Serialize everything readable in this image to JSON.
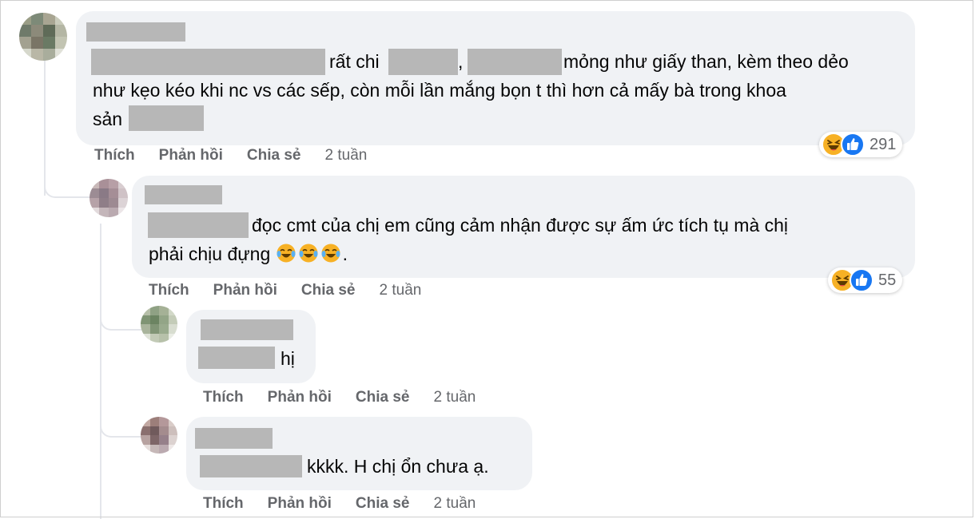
{
  "colors": {
    "bubble_bg": "#f0f2f5",
    "redaction": "#b7b7b7",
    "meta_text": "#65676b",
    "like_blue": "#1877f2",
    "haha_yellow": "#f7b125"
  },
  "comments": [
    {
      "id": "c1",
      "line1_mid": "rất chi",
      "line1_sep": ",",
      "line1_end": "mỏng như giấy than, kèm theo dẻo",
      "line2": "như kẹo kéo khi nc vs các sếp, còn mỗi lần mắng bọn t thì hơn cả mấy bà trong khoa",
      "line3": "sản",
      "actions": {
        "like": "Thích",
        "reply": "Phản hồi",
        "share": "Chia sẻ",
        "time": "2 tuần"
      },
      "reactions": {
        "icons": [
          "haha-icon",
          "like-icon"
        ],
        "count": "291"
      }
    },
    {
      "id": "c2",
      "line1": "đọc cmt của chị em cũng cảm nhận được sự ấm ức tích tụ mà chị",
      "line2": "phải chịu đựng",
      "line2_end": ".",
      "emoji_count": 3,
      "actions": {
        "like": "Thích",
        "reply": "Phản hồi",
        "share": "Chia sẻ",
        "time": "2 tuần"
      },
      "reactions": {
        "icons": [
          "haha-icon",
          "like-icon"
        ],
        "count": "55"
      }
    },
    {
      "id": "c3",
      "line1": "hị",
      "actions": {
        "like": "Thích",
        "reply": "Phản hồi",
        "share": "Chia sẻ",
        "time": "2 tuần"
      }
    },
    {
      "id": "c4",
      "line1": "kkkk. H chị ổn chưa ạ.",
      "actions": {
        "like": "Thích",
        "reply": "Phản hồi",
        "share": "Chia sẻ",
        "time": "2 tuần"
      }
    }
  ]
}
